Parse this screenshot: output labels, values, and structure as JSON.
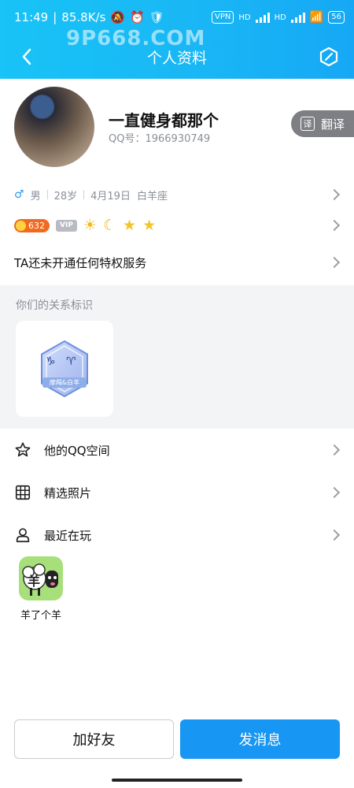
{
  "status_bar": {
    "time": "11:49",
    "speed": "85.8K/s",
    "vpn": "VPN",
    "hd1": "HD",
    "hd2": "HD",
    "battery": "56"
  },
  "watermark": "9P668.COM",
  "nav": {
    "title": "个人资料"
  },
  "profile": {
    "nickname": "一直健身都那个",
    "qq_label": "QQ号：",
    "qq_number": "1966930749",
    "gender_icon": "male-icon",
    "gender": "男",
    "age": "28岁",
    "birthday": "4月19日",
    "zodiac": "白羊座"
  },
  "translate": {
    "label": "翻译"
  },
  "badges": {
    "coin_value": "632",
    "vip_label": "VIP",
    "level_icons": [
      "sun",
      "moon",
      "star",
      "star"
    ]
  },
  "privilege": {
    "text": "TA还未开通任何特权服务"
  },
  "relationship": {
    "title": "你们的关系标识",
    "badge_label": "摩羯&白羊",
    "symbols": [
      "♑",
      "♈"
    ]
  },
  "menu": [
    {
      "label": "他的QQ空间",
      "icon": "star-outline-icon"
    },
    {
      "label": "精选照片",
      "icon": "grid-icon"
    },
    {
      "label": "最近在玩",
      "icon": "game-pin-icon"
    }
  ],
  "recent_game": {
    "name": "羊了个羊",
    "glyph": "羊"
  },
  "actions": {
    "add_friend": "加好友",
    "send_message": "发消息"
  },
  "colors": {
    "header": "#18c3f6",
    "primary_button": "#1796f3",
    "coin": "#f06a1f"
  }
}
